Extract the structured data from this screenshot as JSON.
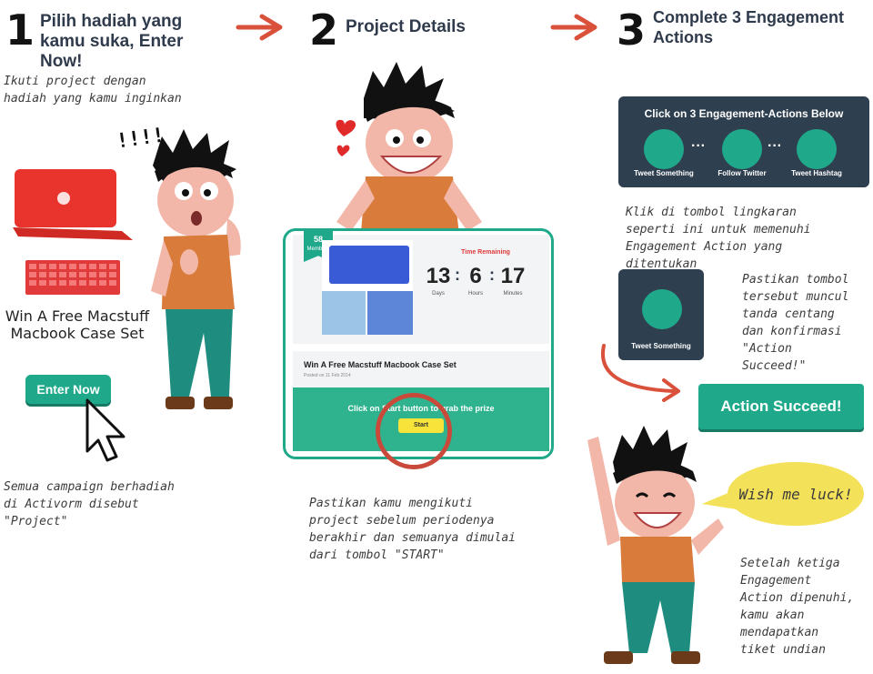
{
  "step1": {
    "number": "1",
    "title": "Pilih hadiah yang kamu suka, Enter Now!",
    "desc": "Ikuti project dengan hadiah yang kamu inginkan",
    "exclaim": "!!!!",
    "product_title": "Win A Free Macstuff Macbook Case Set",
    "enter_button": "Enter Now",
    "footer": "Semua campaign berhadiah di Activorm disebut \"Project\""
  },
  "step2": {
    "number": "2",
    "title": "Project Details",
    "card": {
      "members_count": "58",
      "members_label": "Members",
      "time_remaining_label": "Time Remaining",
      "days": "13",
      "hours": "6",
      "minutes": "17",
      "days_label": "Days",
      "hours_label": "Hours",
      "minutes_label": "Minutes",
      "project_title": "Win A Free Macstuff Macbook Case Set",
      "posted": "Posted on 11 Feb 2014",
      "cta_text": "Click on Start button to grab the prize",
      "start_button": "Start"
    },
    "footer": "Pastikan kamu mengikuti project sebelum periodenya berakhir dan semuanya dimulai dari tombol \"START\""
  },
  "step3": {
    "number": "3",
    "title": "Complete 3 Engagement Actions",
    "panel_title": "Click on 3 Engagement-Actions Below",
    "actions": [
      "Tweet Something",
      "Follow Twitter",
      "Tweet Hashtag"
    ],
    "desc": "Klik di tombol lingkaran seperti ini untuk memenuhi Engagement Action yang ditentukan",
    "small_action": "Tweet Something",
    "confirm_text": "Pastikan tombol tersebut muncul tanda centang dan konfirmasi \"Action Succeed!\"",
    "success_button": "Action Succeed!",
    "bubble": "Wish me luck!",
    "footer": "Setelah ketiga Engagement Action dipenuhi, kamu akan mendapatkan tiket undian"
  },
  "colors": {
    "teal": "#1fa98a",
    "dark": "#2e3f50",
    "arrow_red": "#d9503b",
    "shirt": "#d97b3b",
    "pants": "#1e8c7e",
    "bubble": "#f4e15a"
  }
}
